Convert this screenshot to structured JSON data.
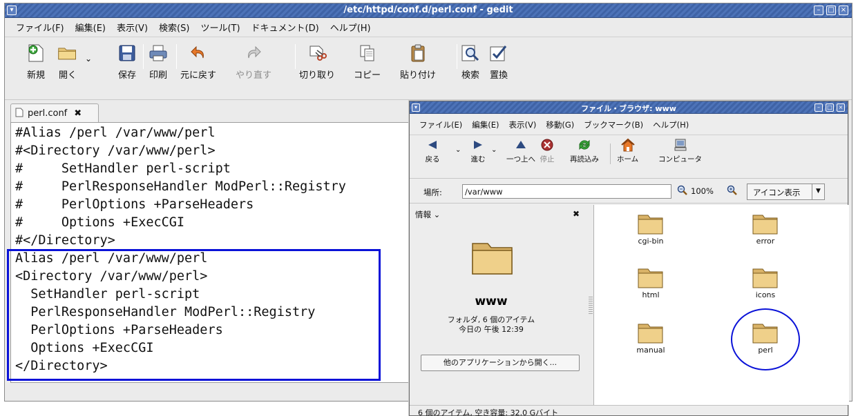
{
  "gedit": {
    "title": "/etc/httpd/conf.d/perl.conf - gedit",
    "menus": [
      "ファイル(F)",
      "編集(E)",
      "表示(V)",
      "検索(S)",
      "ツール(T)",
      "ドキュメント(D)",
      "ヘルプ(H)"
    ],
    "toolbar": {
      "new": "新規",
      "open": "開く",
      "save": "保存",
      "print": "印刷",
      "undo": "元に戻す",
      "redo": "やり直す",
      "cut": "切り取り",
      "copy": "コピー",
      "paste": "貼り付け",
      "find": "検索",
      "replace": "置換"
    },
    "tab_label": "perl.conf",
    "code_lines": [
      "#Alias /perl /var/www/perl",
      "#<Directory /var/www/perl>",
      "#     SetHandler perl-script",
      "#     PerlResponseHandler ModPerl::Registry",
      "#     PerlOptions +ParseHeaders",
      "#     Options +ExecCGI",
      "#</Directory>",
      "Alias /perl /var/www/perl",
      "<Directory /var/www/perl>",
      "  SetHandler perl-script",
      "  PerlResponseHandler ModPerl::Registry",
      "  PerlOptions +ParseHeaders",
      "  Options +ExecCGI",
      "</Directory>"
    ]
  },
  "browser": {
    "title": "ファイル・ブラウザ: www",
    "menus": [
      "ファイル(E)",
      "編集(E)",
      "表示(V)",
      "移動(G)",
      "ブックマーク(B)",
      "ヘルプ(H)"
    ],
    "toolbar": {
      "back": "戻る",
      "forward": "進む",
      "up": "一つ上へ",
      "stop": "停止",
      "reload": "再読込み",
      "home": "ホーム",
      "computer": "コンピュータ"
    },
    "location_label": "場所:",
    "location_value": "/var/www",
    "zoom": "100%",
    "view_mode": "アイコン表示",
    "side_header": "情報",
    "folder_name": "www",
    "folder_info_1": "フォルダ, 6 個のアイテム",
    "folder_info_2": "今日の 午後 12:39",
    "open_with": "他のアプリケーションから開く...",
    "items": [
      "cgi-bin",
      "error",
      "html",
      "icons",
      "manual",
      "perl"
    ],
    "status": "6 個のアイテム, 空き容量: 32.0 Gバイト"
  }
}
